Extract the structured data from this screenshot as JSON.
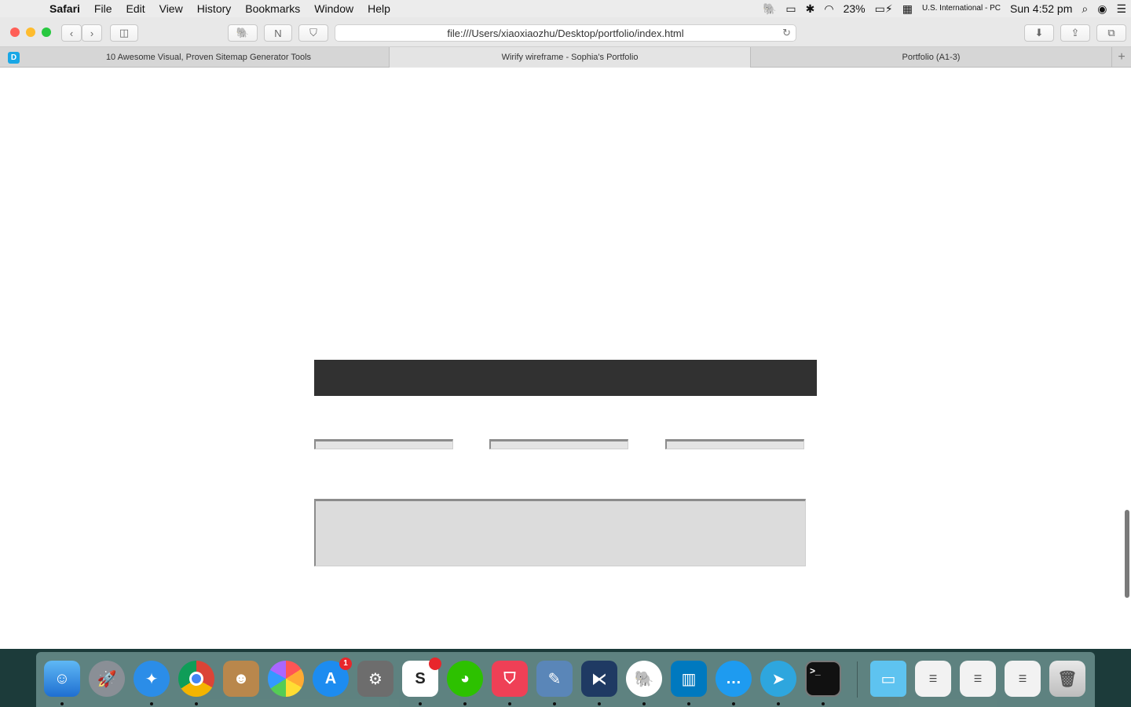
{
  "menubar": {
    "apple_icon": "",
    "app_name": "Safari",
    "menus": [
      "File",
      "Edit",
      "View",
      "History",
      "Bookmarks",
      "Window",
      "Help"
    ],
    "battery": "23%",
    "input_source": "U.S. International - PC",
    "clock": "Sun 4:52 pm"
  },
  "toolbar": {
    "url": "file:///Users/xiaoxiaozhu/Desktop/portfolio/index.html"
  },
  "tabs": [
    {
      "label": "10 Awesome Visual, Proven Sitemap Generator Tools",
      "active": false
    },
    {
      "label": "Wirify wireframe - Sophia's Portfolio",
      "active": true
    },
    {
      "label": "Portfolio (A1-3)",
      "active": false
    }
  ],
  "tab_app_icon_letter": "D",
  "dock": {
    "app_store_badge": "1"
  },
  "colors": {
    "dark_bar": "#313131",
    "wireframe_field": "#dcdcdc",
    "close": "#ff5f57",
    "minimize": "#febc2e",
    "zoom": "#28c840"
  }
}
